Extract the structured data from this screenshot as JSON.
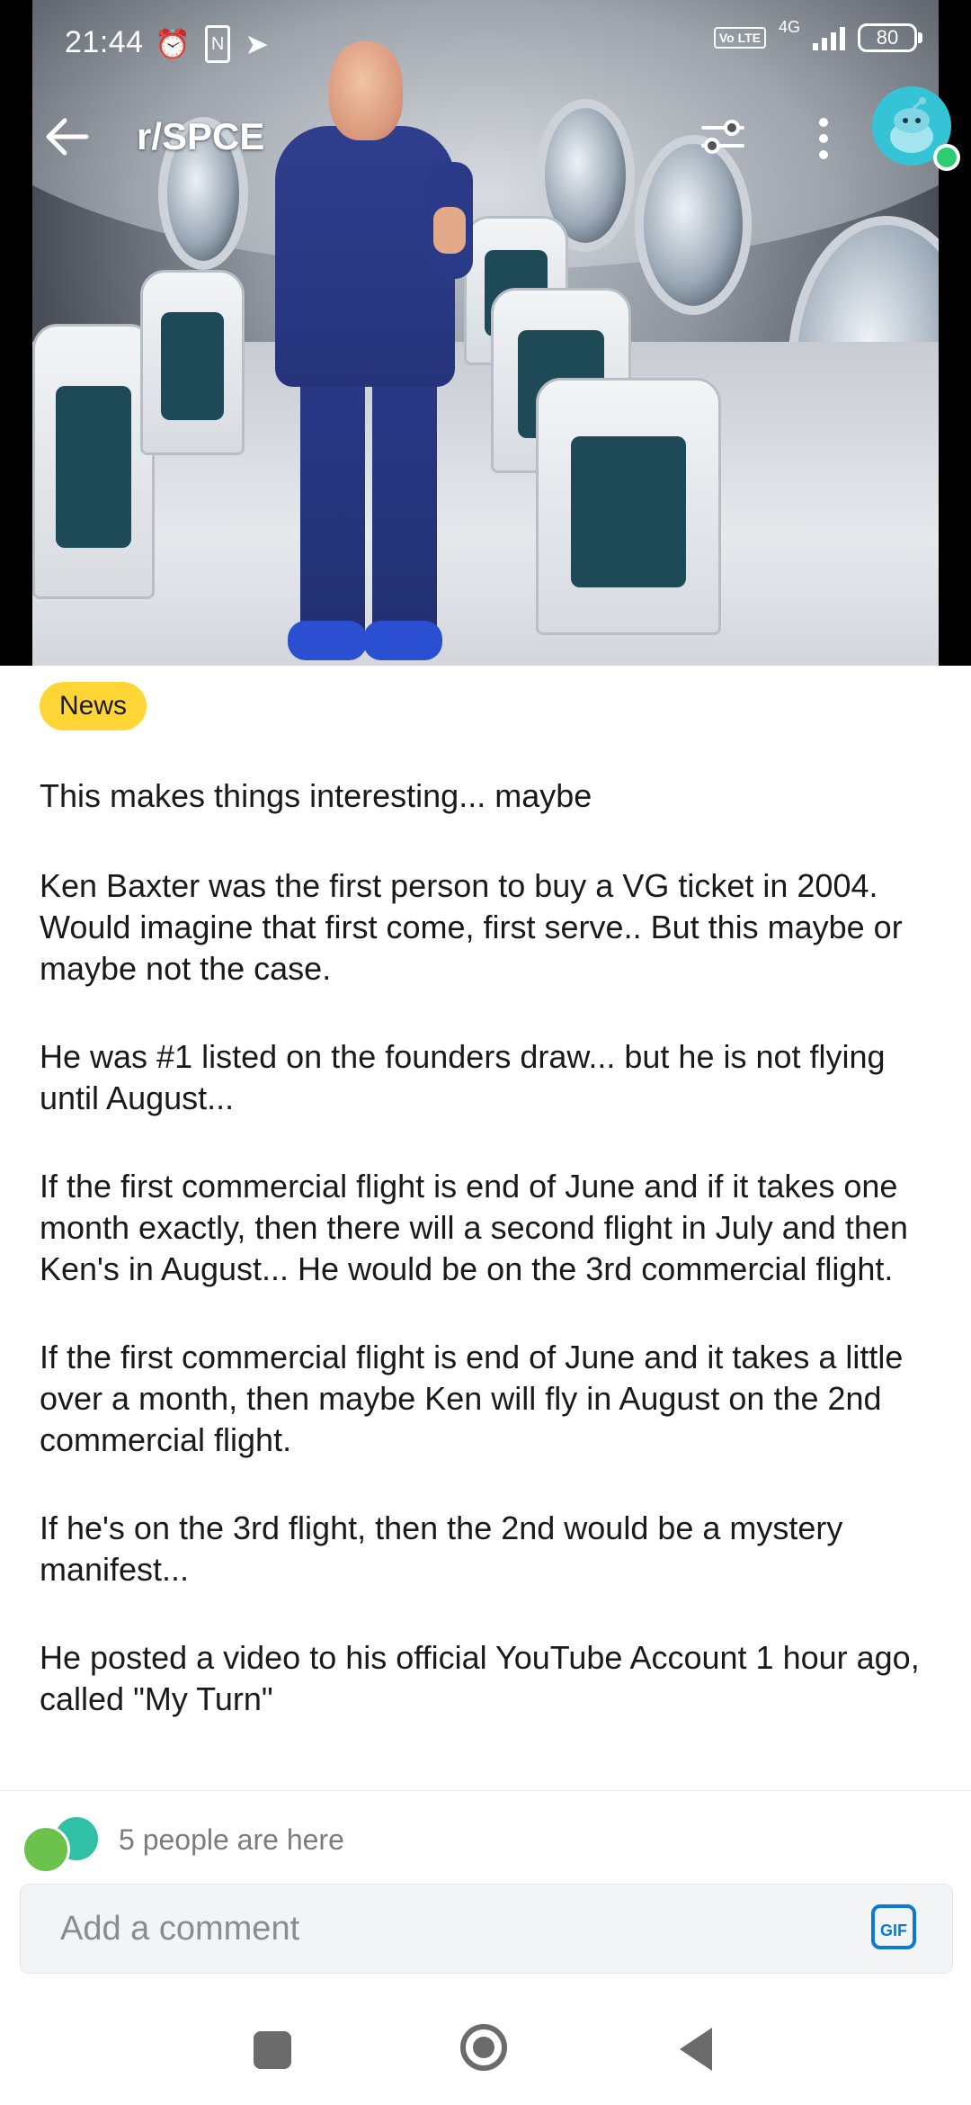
{
  "status_bar": {
    "time": "21:44",
    "network": "4G",
    "volte": "Vo LTE",
    "battery": "80"
  },
  "header": {
    "subreddit": "r/SPCE"
  },
  "post": {
    "flair": "News",
    "flair_color": "#ffd635",
    "title": "This makes things interesting... maybe",
    "paragraphs": [
      "Ken Baxter was the first person to buy a VG ticket in 2004.   Would imagine that first come, first serve.. But this maybe or maybe not the case.",
      "He was #1 listed on the founders draw... but he is not flying until August...",
      "If the first commercial flight is end of June and if it takes one month exactly, then there will a second flight in July and then Ken's in August...  He would be on the 3rd commercial flight.",
      "If the first commercial flight is end of June and it takes a little over a month, then maybe Ken will fly in August on the 2nd commercial flight.",
      "If he's on the 3rd flight, then the 2nd would be a mystery manifest...",
      "He posted a video to his official YouTube Account 1 hour ago, called \"My Turn\""
    ]
  },
  "presence": {
    "text": "5 people are here"
  },
  "comment": {
    "placeholder": "Add a comment",
    "gif_label": "GIF"
  },
  "icons": {
    "back": "arrow-left-icon",
    "filter": "sliders-icon",
    "more": "more-vertical-icon",
    "avatar": "snoo-avatar-icon"
  }
}
